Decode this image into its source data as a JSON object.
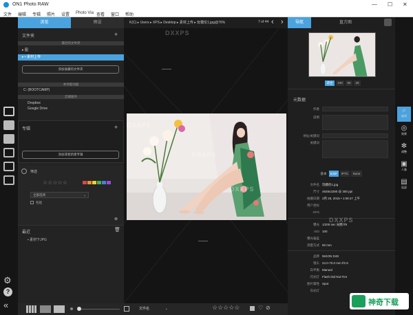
{
  "app": {
    "title": "ON1 Photo RAW"
  },
  "menu": [
    "文件",
    "编辑",
    "专辑",
    "照片",
    "设置",
    "Photo Via",
    "查看",
    "窗口",
    "帮助"
  ],
  "window_controls": {
    "minimize": "—",
    "maximize": "☐",
    "close": "✕"
  },
  "left": {
    "tabs": {
      "browse": "浏览",
      "presets": "预设"
    },
    "folders_title": "文件夹",
    "recent_folders_header": "最近的文件夹",
    "folders": [
      {
        "label": "图",
        "selected": false
      },
      {
        "label": "素材上传",
        "selected": true
      }
    ],
    "add_folder_button": "添加收藏的文件夹",
    "local_drives_header": "本地驱动器",
    "drive": "C: (BOOTCAMP)",
    "cloud_header": "云端服务",
    "cloud_items": [
      "Dropbox",
      "Google Drive"
    ],
    "albums_title": "专辑",
    "new_album_button": "添加或者新建专辑",
    "filter_title": "筛选",
    "filter_select": "全部选项",
    "filter_checkbox_label": "包括",
    "recent_title": "最近",
    "recent_item": "素材下JPG",
    "add_icon": "+"
  },
  "center": {
    "breadcrumb": "K(C) ▸ Users ▸ XPS ▸ Desktop ▸ 素材上传 ▸ 玩模伦1.jpg@76%",
    "counter": "7 of 44",
    "watermark": "DXXPS"
  },
  "right": {
    "tabs": {
      "navigator": "导航",
      "histogram": "直方图"
    },
    "zoom_levels": [
      "适合",
      "100",
      "50",
      "25"
    ],
    "metadata_title": "元数据",
    "meta_fields": [
      "作者",
      "说明",
      "",
      "地址/关键词",
      "关键词"
    ],
    "exif_tabs": [
      "基本",
      "EXIF",
      "IPTC",
      "None"
    ],
    "exif": [
      {
        "label": "文件名",
        "value": "玩模伦1.jpg"
      },
      {
        "label": "尺寸",
        "value": "4928x3280 @ 300 ppi"
      },
      {
        "label": "拍摄日期",
        "value": "2月 26, 2015 • 1:08:47 上午"
      },
      {
        "label": "用户坐标",
        "value": ""
      },
      {
        "label": "GPS",
        "value": ""
      },
      {
        "label": "曝光",
        "value": "1/200 sec 光圈 f/9"
      },
      {
        "label": "ISO",
        "value": "100"
      },
      {
        "label": "曝光偏差",
        "value": ""
      },
      {
        "label": "测量方式",
        "value": "50 mm"
      },
      {
        "label": "品牌",
        "value": "NIKON D4S"
      },
      {
        "label": "镜头",
        "value": "24.0-70.0 mm f/2.8"
      },
      {
        "label": "白平衡",
        "value": "Manual"
      },
      {
        "label": "闪光灯",
        "value": "Flash Did Not Fire"
      },
      {
        "label": "图片属性",
        "value": "Spot"
      },
      {
        "label": "白光灯",
        "value": ""
      }
    ]
  },
  "right_rail": [
    "编辑",
    "效果",
    "调整",
    "人像",
    "局部"
  ],
  "bottom": {
    "sort_select": "文件名",
    "stars": "☆☆☆☆☆"
  },
  "brand": {
    "text": "神奇下载",
    "color": "#1aa05a"
  },
  "colors": {
    "accent": "#4aa3df",
    "label_red": "#d94848",
    "label_orange": "#e8913a",
    "label_yellow": "#e8d23a",
    "label_green": "#4ab34a",
    "label_blue": "#4a7fd9",
    "label_purple": "#9a4ad9"
  }
}
